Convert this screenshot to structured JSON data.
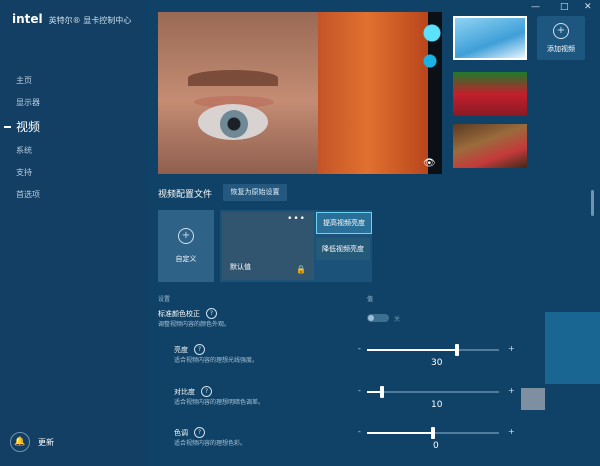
{
  "app": {
    "logo": "intel",
    "title": "英特尔® 显卡控制中心"
  },
  "sidebar": {
    "items": [
      {
        "label": "主页"
      },
      {
        "label": "显示器"
      },
      {
        "label": "视频"
      },
      {
        "label": "系统"
      },
      {
        "label": "支持"
      },
      {
        "label": "首选项"
      }
    ],
    "update_label": "更新"
  },
  "window": {
    "minimize": "—",
    "maximize": "□",
    "close": "✕"
  },
  "media": {
    "add_video_label": "添加视频"
  },
  "profile": {
    "header": "视频配置文件",
    "restore_label": "恢复为原始设置",
    "custom_label": "自定义",
    "default_label": "默认值",
    "enhance_label": "提高视频亮度",
    "reduce_label": "降低视频亮度"
  },
  "settings": {
    "col_setting": "设置",
    "col_value": "值",
    "rows": [
      {
        "title": "标准颜色校正",
        "desc": "调整视频内容的颜色外观。",
        "toggle_text": "关"
      },
      {
        "title": "亮度",
        "desc": "适合视频内容的理想光线强度。",
        "value": 30,
        "fraction": 0.68
      },
      {
        "title": "对比度",
        "desc": "适合视频内容的理想明暗色调差。",
        "value": 10,
        "fraction": 0.11
      },
      {
        "title": "色调",
        "desc": "适合视频内容的理想色彩。",
        "value": 0,
        "fraction": 0.5
      }
    ]
  }
}
